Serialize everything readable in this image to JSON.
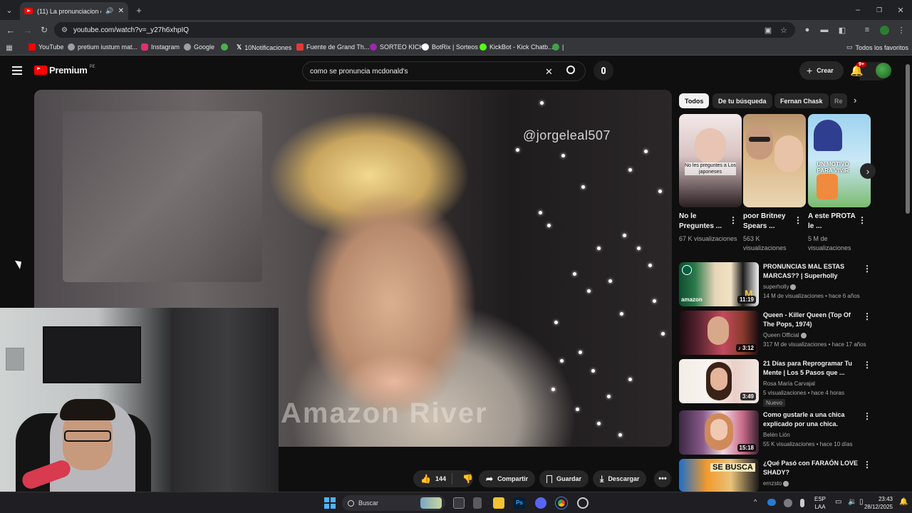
{
  "browser": {
    "tab_title": "(11) La pronunciacion corre",
    "url": "youtube.com/watch?v=_y27h6xhpIQ",
    "bookmarks": [
      {
        "label": "YouTube",
        "color": "#ff0000"
      },
      {
        "label": "pretium iustum mat...",
        "color": "#9aa0a6"
      },
      {
        "label": "Instagram",
        "color": "#e1306c"
      },
      {
        "label": "Google",
        "color": "#9aa0a6"
      },
      {
        "label": "",
        "color": "#4caf50"
      },
      {
        "label": "10Notificaciones",
        "color": "#ffffff"
      },
      {
        "label": "Fuente de Grand Th...",
        "color": "#e53935"
      },
      {
        "label": "SORTEO KICK",
        "color": "#9c27b0"
      },
      {
        "label": "BotRix | Sorteos",
        "color": "#ffffff"
      },
      {
        "label": "KickBot - Kick Chatb...",
        "color": "#53fc18"
      },
      {
        "label": "|",
        "color": "#43a047"
      }
    ],
    "all_favorites": "Todos los favoritos"
  },
  "youtube": {
    "logo": "Premium",
    "logo_country": "PE",
    "search_query": "como se pronuncia mcdonald's",
    "create_label": "Crear",
    "notifications_badge": "9+"
  },
  "video": {
    "watermark": "@jorgeleal507",
    "caption": "Amazon River"
  },
  "actions": {
    "likes": "144",
    "share": "Compartir",
    "save": "Guardar",
    "download": "Descargar"
  },
  "chips": [
    "Todos",
    "De tu búsqueda",
    "Fernan Chask",
    "Re"
  ],
  "shorts": [
    {
      "title": "No le Preguntes ...",
      "views": "67 K visualizaciones",
      "overlay": "No les preguntes a Los japoneses"
    },
    {
      "title": "poor Britney Spears ...",
      "views": "563 K visualizaciones",
      "overlay": ""
    },
    {
      "title": "A este PROTA le ...",
      "views": "5 M de visualizaciones",
      "overlay": "UN MOTIVO PARA VIVIR"
    }
  ],
  "related": [
    {
      "title": "PRONUNCIAS MAL ESTAS MARCAS?? | Superholly",
      "channel": "superholly",
      "meta": "14 M de visualizaciones • hace 6 años",
      "duration": "11:19"
    },
    {
      "title": "Queen - Killer Queen (Top Of The Pops, 1974)",
      "channel": "Queen Official",
      "meta": "317 M de visualizaciones • hace 17 años",
      "duration": "3:12"
    },
    {
      "title": "21 Días para Reprogramar Tu Mente | Los 5 Pasos que ...",
      "channel": "Rosa María Carvajal",
      "meta": "5 visualizaciones • hace 4 horas",
      "duration": "3:49",
      "badge": "Nuevo"
    },
    {
      "title": "Como gustarle a una chica explicado por una chica.",
      "channel": "Belén Lión",
      "meta": "55 K visualizaciones • hace 10 días",
      "duration": "15:18"
    },
    {
      "title": "¿Qué Pasó con FARAÓN LOVE SHADY?",
      "channel": "ernzsto",
      "meta": "",
      "duration": ""
    }
  ],
  "thumb_overlays": {
    "r0_amazon": "amazon",
    "r4_sebusca": "SE BUSCA"
  },
  "taskbar": {
    "search_label": "Buscar",
    "lang": "ESP",
    "lang2": "LAA",
    "time": "23:43",
    "date": "28/12/2025"
  },
  "colors": {
    "accent_red": "#ff0000",
    "background": "#0f0f0f",
    "chip_bg": "#272727"
  }
}
